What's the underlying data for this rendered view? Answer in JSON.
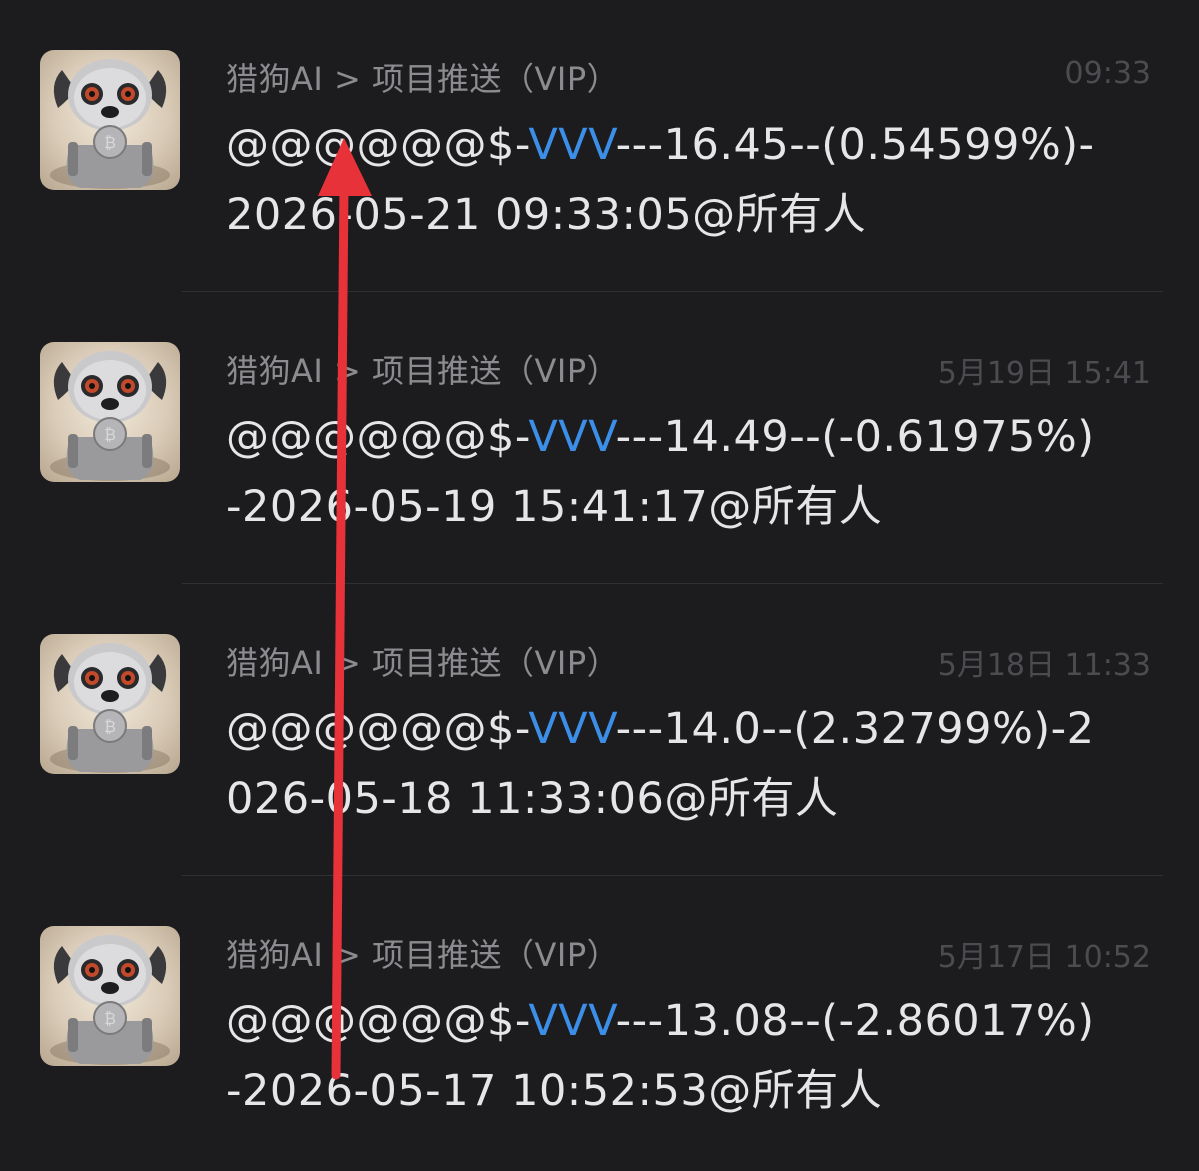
{
  "messages": [
    {
      "sender": "猎狗AI > 项目推送（VIP）",
      "time": "09:33",
      "prefix": "@@@@@@$-",
      "ticker": "VVV",
      "suffix": "---16.45--(0.54599%)-2026-05-21 09:33:05@所有人"
    },
    {
      "sender": "猎狗AI > 项目推送（VIP）",
      "time": "5月19日 15:41",
      "prefix": "@@@@@@$-",
      "ticker": "VVV",
      "suffix": "---14.49--(-0.61975%)-2026-05-19 15:41:17@所有人"
    },
    {
      "sender": "猎狗AI > 项目推送（VIP）",
      "time": "5月18日 11:33",
      "prefix": "@@@@@@$-",
      "ticker": "VVV",
      "suffix": "---14.0--(2.32799%)-2026-05-18 11:33:06@所有人"
    },
    {
      "sender": "猎狗AI > 项目推送（VIP）",
      "time": "5月17日 10:52",
      "prefix": "@@@@@@$-",
      "ticker": "VVV",
      "suffix": "---13.08--(-2.86017%)-2026-05-17 10:52:53@所有人"
    }
  ],
  "colors": {
    "background": "#1c1c1e",
    "ticker": "#3c8fe8",
    "annotation_arrow": "#e8323a"
  },
  "icons": {
    "avatar": "robot-dog-bitcoin-avatar",
    "annotation": "red-up-arrow"
  }
}
